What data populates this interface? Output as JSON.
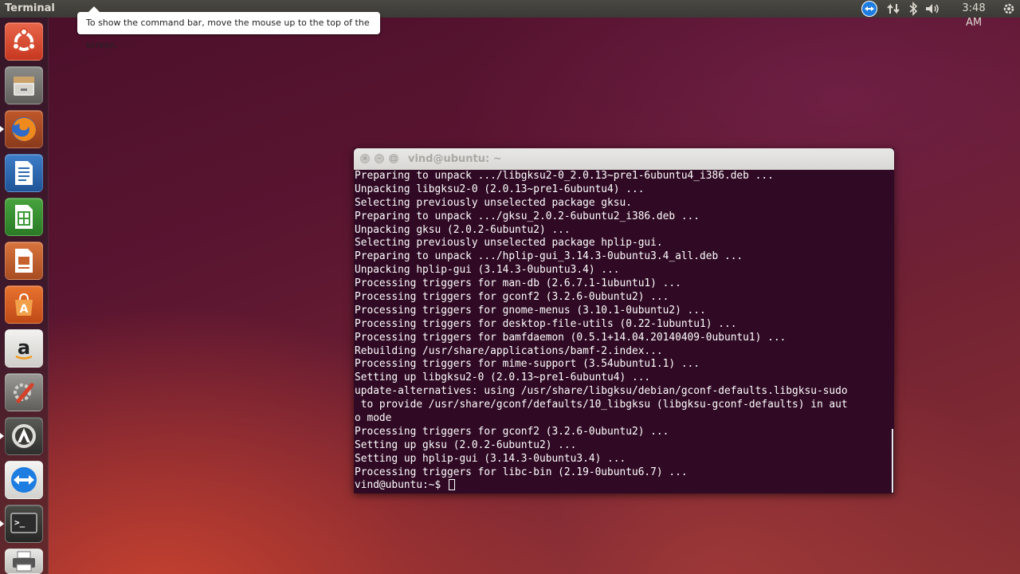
{
  "top_panel": {
    "app_title": "Terminal",
    "clock": "3:48 AM",
    "indicators": [
      "teamviewer-icon",
      "network-icon",
      "bluetooth-icon",
      "volume-icon",
      "gear-icon"
    ]
  },
  "hint": {
    "text": "To show the command bar, move the mouse up to the top of the screen."
  },
  "launcher": {
    "items": [
      {
        "name": "ubuntu-dash",
        "icon": "ubuntu-logo-icon"
      },
      {
        "name": "files",
        "icon": "file-cabinet-icon"
      },
      {
        "name": "firefox",
        "icon": "firefox-icon"
      },
      {
        "name": "libreoffice-writer",
        "icon": "writer-icon"
      },
      {
        "name": "libreoffice-calc",
        "icon": "calc-icon"
      },
      {
        "name": "libreoffice-impress",
        "icon": "impress-icon"
      },
      {
        "name": "ubuntu-software-center",
        "icon": "shopping-bag-icon"
      },
      {
        "name": "amazon",
        "icon": "amazon-icon"
      },
      {
        "name": "system-settings",
        "icon": "settings-wrench-icon"
      },
      {
        "name": "software-updater",
        "icon": "updater-icon"
      },
      {
        "name": "teamviewer",
        "icon": "teamviewer-icon"
      },
      {
        "name": "terminal",
        "icon": "terminal-icon"
      },
      {
        "name": "printer",
        "icon": "printer-icon"
      }
    ],
    "ubuntu_glyph": "◎",
    "amazon_glyph": "a",
    "terminal_glyph": ">_",
    "software_glyph": "A"
  },
  "terminal": {
    "title": "vind@ubuntu: ~",
    "close_glyph": "×",
    "min_glyph": "–",
    "max_glyph": "□",
    "lines": [
      "Preparing to unpack .../libgksu2-0_2.0.13~pre1-6ubuntu4_i386.deb ...",
      "Unpacking libgksu2-0 (2.0.13~pre1-6ubuntu4) ...",
      "Selecting previously unselected package gksu.",
      "Preparing to unpack .../gksu_2.0.2-6ubuntu2_i386.deb ...",
      "Unpacking gksu (2.0.2-6ubuntu2) ...",
      "Selecting previously unselected package hplip-gui.",
      "Preparing to unpack .../hplip-gui_3.14.3-0ubuntu3.4_all.deb ...",
      "Unpacking hplip-gui (3.14.3-0ubuntu3.4) ...",
      "Processing triggers for man-db (2.6.7.1-1ubuntu1) ...",
      "Processing triggers for gconf2 (3.2.6-0ubuntu2) ...",
      "Processing triggers for gnome-menus (3.10.1-0ubuntu2) ...",
      "Processing triggers for desktop-file-utils (0.22-1ubuntu1) ...",
      "Processing triggers for bamfdaemon (0.5.1+14.04.20140409-0ubuntu1) ...",
      "Rebuilding /usr/share/applications/bamf-2.index...",
      "Processing triggers for mime-support (3.54ubuntu1.1) ...",
      "Setting up libgksu2-0 (2.0.13~pre1-6ubuntu4) ...",
      "update-alternatives: using /usr/share/libgksu/debian/gconf-defaults.libgksu-sudo",
      " to provide /usr/share/gconf/defaults/10_libgksu (libgksu-gconf-defaults) in aut",
      "o mode",
      "Processing triggers for gconf2 (3.2.6-0ubuntu2) ...",
      "Setting up gksu (2.0.2-6ubuntu2) ...",
      "Setting up hplip-gui (3.14.3-0ubuntu3.4) ...",
      "Processing triggers for libc-bin (2.19-0ubuntu6.7) ..."
    ],
    "prompt": "vind@ubuntu:~$ "
  },
  "colors": {
    "terminal_bg": "#300a24",
    "terminal_fg": "#ffffff",
    "panel_bg": "#3c3b37",
    "launcher_firefox": "#e8721c",
    "launcher_writer": "#2b6cb0",
    "launcher_calc": "#3b9b35",
    "launcher_impress": "#c8602c",
    "launcher_software": "#e25b1a",
    "launcher_settings": "#c44a2e",
    "launcher_teamviewer": "#1e7de0"
  }
}
